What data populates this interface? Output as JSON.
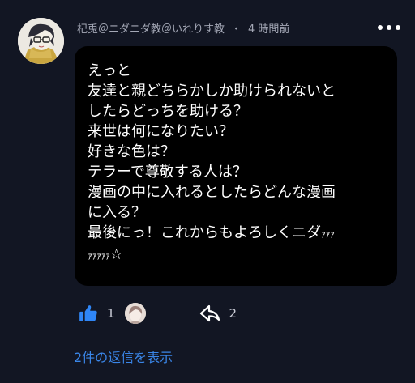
{
  "comment": {
    "author": "杞兎＠ニダニダ教＠いれりす教",
    "separator": "・",
    "time": "4 時間前",
    "lines": [
      {
        "text": "えっと"
      },
      {
        "text": "友達と親どちらかしか助けられないと"
      },
      {
        "text": "したらどっちを助ける？"
      },
      {
        "text": "来世は何になりたい？"
      },
      {
        "text": "好きな色は？"
      },
      {
        "text": "テラーで尊敬する人は？"
      },
      {
        "text": "漫画の中に入れるとしたらどんな漫画"
      },
      {
        "text": "に入る？"
      },
      {
        "text": "最後にっ！これからもよろしくニダ",
        "small": "ｧｧｧ"
      },
      {
        "text": "",
        "small": "ｧｧｧｧｧ",
        "tail": "☆"
      }
    ]
  },
  "actions": {
    "like_count": "1",
    "reply_count": "2"
  },
  "view_replies_label": "2件の返信を表示",
  "icons": {
    "like": "thumbs-up-icon",
    "reply": "reply-arrow-icon",
    "more": "more-dots-icon"
  },
  "colors": {
    "background": "#121623",
    "bubble": "#000000",
    "accent": "#3a86e8",
    "meta_text": "#a4a8b6"
  }
}
